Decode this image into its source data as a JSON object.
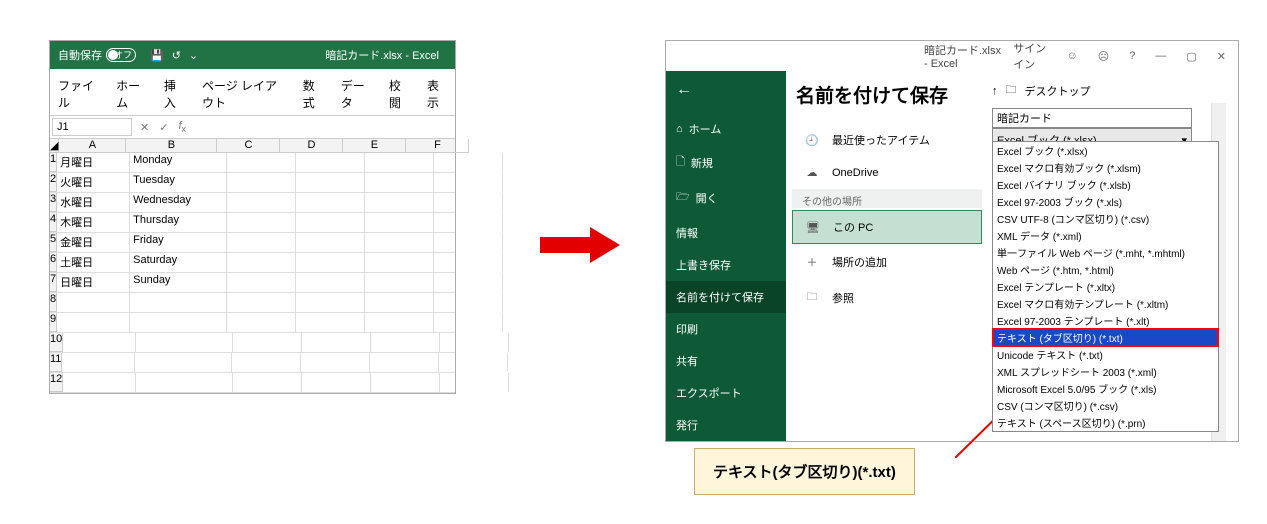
{
  "left": {
    "autosave_label": "自動保存",
    "autosave_state": "オフ",
    "title": "暗記カード.xlsx  -  Excel",
    "ribbon_tabs": [
      "ファイル",
      "ホーム",
      "挿入",
      "ページ レイアウト",
      "数式",
      "データ",
      "校閲",
      "表示"
    ],
    "namebox": "J1",
    "columns": [
      "A",
      "B",
      "C",
      "D",
      "E",
      "F"
    ],
    "rows": [
      {
        "n": 1,
        "A": "月曜日",
        "B": "Monday"
      },
      {
        "n": 2,
        "A": "火曜日",
        "B": "Tuesday"
      },
      {
        "n": 3,
        "A": "水曜日",
        "B": "Wednesday"
      },
      {
        "n": 4,
        "A": "木曜日",
        "B": "Thursday"
      },
      {
        "n": 5,
        "A": "金曜日",
        "B": "Friday"
      },
      {
        "n": 6,
        "A": "土曜日",
        "B": "Saturday"
      },
      {
        "n": 7,
        "A": "日曜日",
        "B": "Sunday"
      },
      {
        "n": 8,
        "A": "",
        "B": ""
      },
      {
        "n": 9,
        "A": "",
        "B": ""
      },
      {
        "n": 10,
        "A": "",
        "B": ""
      },
      {
        "n": 11,
        "A": "",
        "B": ""
      },
      {
        "n": 12,
        "A": "",
        "B": ""
      }
    ]
  },
  "right": {
    "doc_title": "暗記カード.xlsx  -  Excel",
    "signin": "サインイン",
    "help": "?",
    "nav": {
      "home": "ホーム",
      "new": "新規",
      "open": "開く",
      "info": "情報",
      "save": "上書き保存",
      "saveas": "名前を付けて保存",
      "print": "印刷",
      "share": "共有",
      "export": "エクスポート",
      "publish": "発行"
    },
    "page_title": "名前を付けて保存",
    "locations": {
      "recent": "最近使ったアイテム",
      "onedrive": "OneDrive",
      "other_header": "その他の場所",
      "this_pc": "この PC",
      "add_place": "場所の追加",
      "browse": "参照"
    },
    "dest": {
      "up": "↑",
      "folder_label": "デスクトップ",
      "filename": "暗記カード",
      "selected_type": "Excel ブック (*.xlsx)"
    },
    "types": [
      "Excel ブック (*.xlsx)",
      "Excel マクロ有効ブック (*.xlsm)",
      "Excel バイナリ ブック (*.xlsb)",
      "Excel 97-2003 ブック (*.xls)",
      "CSV UTF-8 (コンマ区切り) (*.csv)",
      "XML データ (*.xml)",
      "単一ファイル Web ページ (*.mht, *.mhtml)",
      "Web ページ (*.htm, *.html)",
      "Excel テンプレート (*.xltx)",
      "Excel マクロ有効テンプレート (*.xltm)",
      "Excel 97-2003 テンプレート (*.xlt)",
      "テキスト (タブ区切り) (*.txt)",
      "Unicode テキスト (*.txt)",
      "XML スプレッドシート 2003 (*.xml)",
      "Microsoft Excel 5.0/95 ブック (*.xls)",
      "CSV (コンマ区切り) (*.csv)",
      "テキスト (スペース区切り) (*.prn)"
    ],
    "highlight_index": 11
  },
  "callout": "テキスト(タブ区切り)(*.txt)"
}
